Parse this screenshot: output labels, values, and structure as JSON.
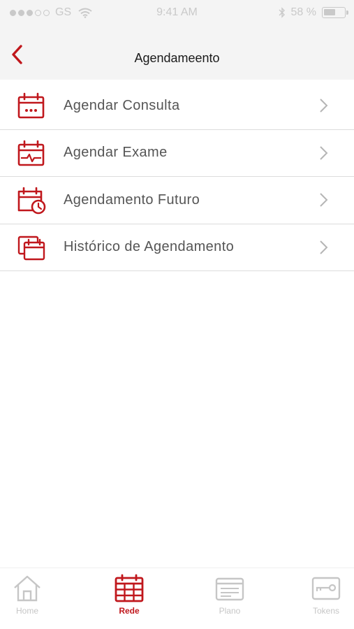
{
  "status_bar": {
    "carrier": "GS",
    "time": "9:41 AM",
    "battery_text": "58 %",
    "battery_level": 0.58
  },
  "nav": {
    "title": "Agendameento",
    "back_icon": "chevron-left-icon"
  },
  "menu": {
    "items": [
      {
        "label": "Agendar Consulta",
        "icon": "calendar-dots-icon"
      },
      {
        "label": "Agendar Exame",
        "icon": "calendar-pulse-icon"
      },
      {
        "label": "Agendamento Futuro",
        "icon": "calendar-clock-icon"
      },
      {
        "label": "Histórico de Agendamento",
        "icon": "calendar-stack-icon"
      }
    ]
  },
  "tabs": [
    {
      "label": "Home",
      "icon": "home-icon",
      "active": false
    },
    {
      "label": "Rede",
      "icon": "calendar-grid-icon",
      "active": true
    },
    {
      "label": "Plano",
      "icon": "card-icon",
      "active": false
    },
    {
      "label": "Tokens",
      "icon": "key-icon",
      "active": false
    }
  ],
  "colors": {
    "accent": "#c0171c",
    "text": "#555555",
    "inactive": "#c6c6c6",
    "bar_bg": "#f4f4f4"
  }
}
